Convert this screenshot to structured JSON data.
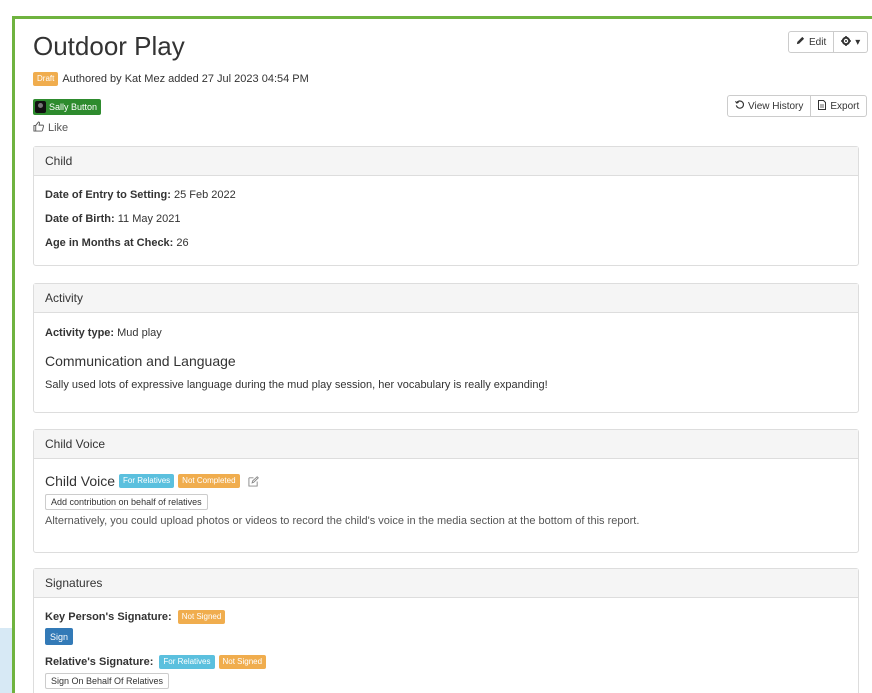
{
  "title": "Outdoor Play",
  "toolbar": {
    "edit_label": "Edit",
    "settings_caret": "▾",
    "view_history_label": "View History",
    "export_label": "Export"
  },
  "meta": {
    "status_badge": "Draft",
    "authored_text": "Authored by Kat Mez added 27 Jul 2023 04:54 PM"
  },
  "child_chip": {
    "name": "Sally Button"
  },
  "like": {
    "label": "Like"
  },
  "child_panel": {
    "heading": "Child",
    "entry_label": "Date of Entry to Setting:",
    "entry_value": "25 Feb 2022",
    "dob_label": "Date of Birth:",
    "dob_value": "11 May 2021",
    "age_label": "Age in Months at Check:",
    "age_value": "26"
  },
  "activity_panel": {
    "heading": "Activity",
    "type_label": "Activity type:",
    "type_value": "Mud play",
    "subheading": "Communication and Language",
    "text": "Sally used lots of expressive language during the mud play session, her vocabulary is really expanding!"
  },
  "child_voice_panel": {
    "heading": "Child Voice",
    "subheading": "Child Voice",
    "badge_relatives": "For Relatives",
    "badge_status": "Not Completed",
    "add_button": "Add contribution on behalf of relatives",
    "hint": "Alternatively, you could upload photos or videos to record the child's voice in the media section at the bottom of this report."
  },
  "signatures_panel": {
    "heading": "Signatures",
    "key_person_label": "Key Person's Signature:",
    "key_person_status": "Not Signed",
    "sign_button": "Sign",
    "relative_label": "Relative's Signature:",
    "relative_badge": "For Relatives",
    "relative_status": "Not Signed",
    "sign_on_behalf_button": "Sign On Behalf Of Relatives"
  },
  "colors": {
    "accent_green": "#6fb33f",
    "chip_green": "#2e8b2e",
    "info": "#5bc0de",
    "warning": "#f0ad4e",
    "primary": "#337ab7"
  }
}
